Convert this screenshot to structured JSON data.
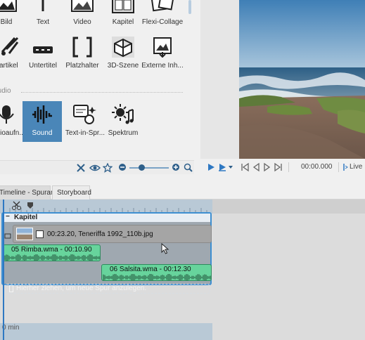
{
  "toolbox": {
    "tiles_row1": [
      "Bild",
      "Text",
      "Video",
      "Kapitel",
      "Flexi-Collage"
    ],
    "tiles_row2": [
      "Partikel",
      "Untertitel",
      "Platzhalter",
      "3D-Szene",
      "Externe Inh..."
    ],
    "section_audio": "Audio",
    "tiles_row3": [
      "Audioaufn...",
      "Sound",
      "Text-in-Spr...",
      "Spektrum"
    ],
    "selected_tile": "Sound"
  },
  "preview": {
    "time": "00:00.000",
    "live_label": "Live"
  },
  "tabs": {
    "timeline": "Timeline - Spuransicht",
    "storyboard": "Storyboard"
  },
  "timeline": {
    "chapter_title": "Kapitel",
    "image_object": "00:23.20, Teneriffa 1992_110b.jpg",
    "audio_1": "05 Rimba.wma - 00:10.90",
    "audio_2": "06 Salsita.wma - 00:12.30",
    "drop_hint": "Hierher ziehen, um neue Spur anzulegen.",
    "track2_label": "0 min"
  },
  "colors": {
    "accent": "#4a86b8",
    "audio": "#67d49c",
    "chapter_border": "#3e8fd1"
  }
}
